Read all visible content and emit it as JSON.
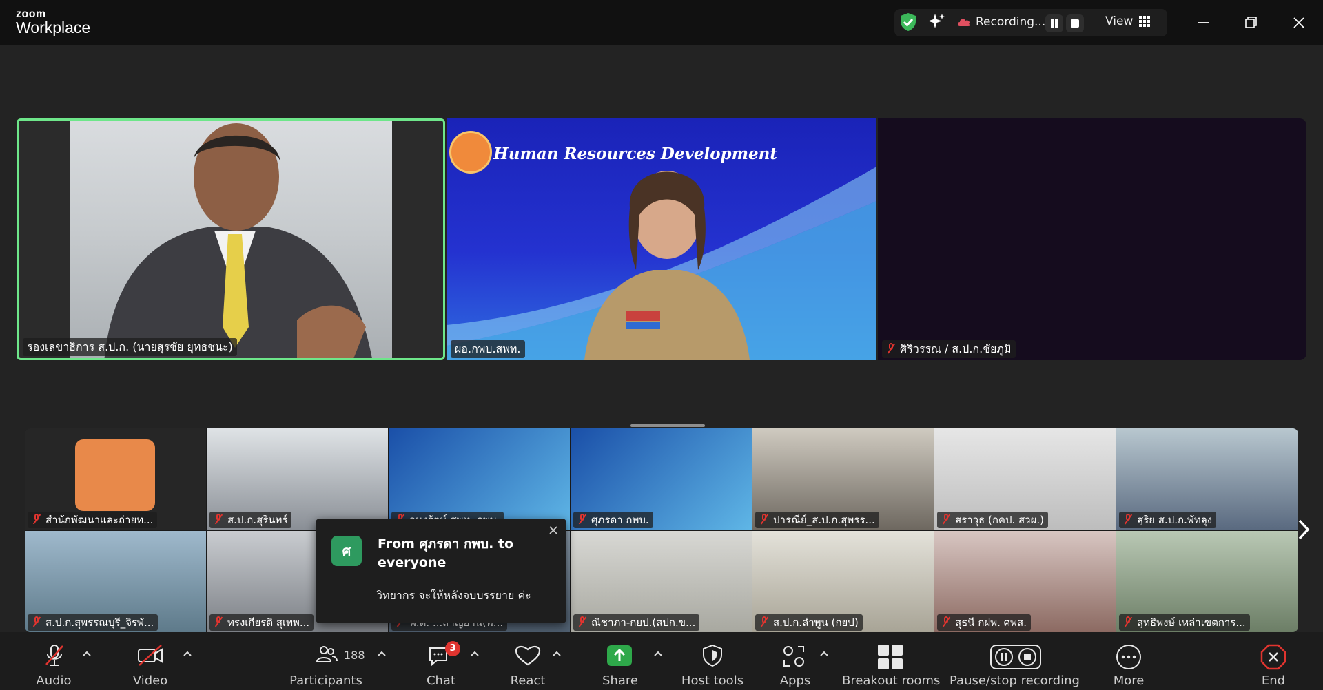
{
  "app": {
    "logo_top": "zoom",
    "logo_bottom": "Workplace"
  },
  "header": {
    "recording_label": "Recording...",
    "view_label": "View"
  },
  "speakers": [
    {
      "name": "รองเลขาธิการ ส.ป.ก. (นายสุรชัย ยุทธชนะ)",
      "muted": false
    },
    {
      "name": "ผอ.กพบ.สพท.",
      "muted": false,
      "banner": "Human Resources Development"
    },
    {
      "name": "ศิริวรรณ / ส.ป.ก.ชัยภูมิ",
      "muted": true
    }
  ],
  "gallery": [
    {
      "name": "สำนักพัฒนาและถ่ายท..."
    },
    {
      "name": "ส.ป.ก.สุรินทร์"
    },
    {
      "name": "อนงรัตน์ สพท. กพบ."
    },
    {
      "name": "ศุภรดา กพบ."
    },
    {
      "name": "ปารณีย์_ส.ป.ก.สุพรร..."
    },
    {
      "name": "สราวุธ (กคป. สวผ.)"
    },
    {
      "name": "สุริย ส.ป.ก.พัทลุง"
    },
    {
      "name": "ส.ป.ก.สุพรรณบุรี_จิรพั..."
    },
    {
      "name": "ทรงเกียรติ สุเทพ..."
    },
    {
      "name": "พ.ต. ...สาญยาน(พ..."
    },
    {
      "name": "ณิชาภา-กยป.(สปก.ข..."
    },
    {
      "name": "ส.ป.ก.ลำพูน (กยป)"
    },
    {
      "name": "สุธนี กฝพ. ศพส."
    },
    {
      "name": "สุทธิพงษ์ เหล่าเขตการ..."
    }
  ],
  "chat_popup": {
    "avatar_letter": "ศ",
    "header": "From ศุภรดา กพบ. to everyone",
    "message": "วิทยากร จะให้หลังจบบรรยาย ค่ะ"
  },
  "toolbar": {
    "audio": "Audio",
    "video": "Video",
    "participants": "Participants",
    "participants_count": "188",
    "chat": "Chat",
    "chat_badge": "3",
    "react": "React",
    "share": "Share",
    "host_tools": "Host tools",
    "apps": "Apps",
    "breakout_rooms": "Breakout rooms",
    "pause_stop_recording": "Pause/stop recording",
    "more": "More",
    "end": "End"
  },
  "colors": {
    "active_speaker_border": "#6ee68a",
    "share_green": "#2ea84a",
    "end_red": "#e0342f",
    "badge_red": "#e0342f"
  }
}
